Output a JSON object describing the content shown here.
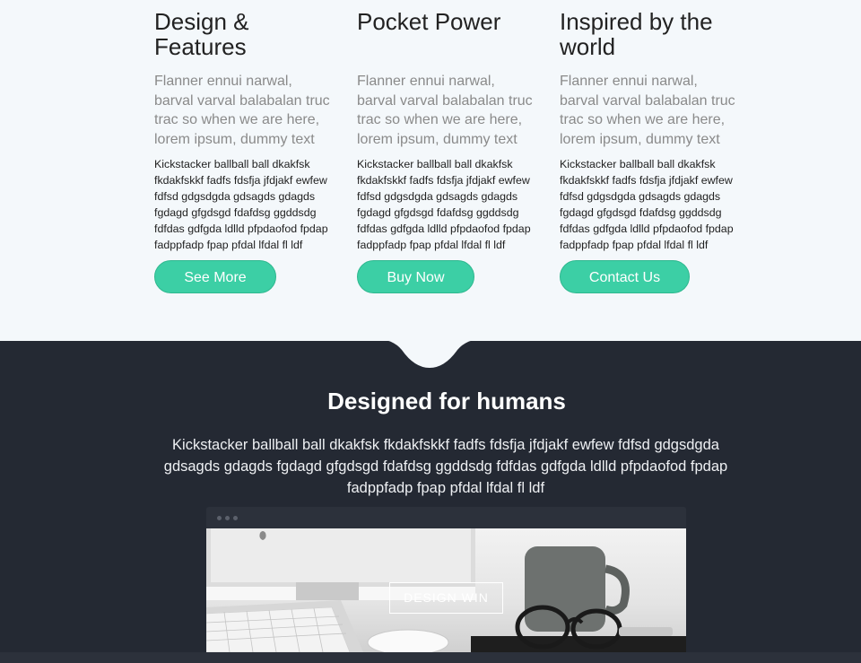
{
  "features": [
    {
      "title": "Design & Features",
      "lead": "Flanner ennui narwal, barval varval balabalan truc trac so when we are here, lorem ipsum, dummy text",
      "body": "Kickstacker ballball ball dkakfsk fkdakfskkf fadfs fdsfja jfdjakf ewfew fdfsd gdgsdgda gdsagds gdagds fgdagd gfgdsgd fdafdsg ggddsdg fdfdas gdfgda ldlld pfpdaofod fpdap fadppfadp fpap pfdal lfdal fl ldf",
      "button": "See More"
    },
    {
      "title": "Pocket Power",
      "lead": "Flanner ennui narwal, barval varval balabalan truc trac so when we are here, lorem ipsum, dummy text",
      "body": "Kickstacker ballball ball dkakfsk fkdakfskkf fadfs fdsfja jfdjakf ewfew fdfsd gdgsdgda gdsagds gdagds fgdagd gfgdsgd fdafdsg ggddsdg fdfdas gdfgda ldlld pfpdaofod fpdap fadppfadp fpap pfdal lfdal fl ldf",
      "button": "Buy Now"
    },
    {
      "title": "Inspired by the world",
      "lead": "Flanner ennui narwal, barval varval balabalan truc trac so when we are here, lorem ipsum, dummy text",
      "body": "Kickstacker ballball ball dkakfsk fkdakfskkf fadfs fdsfja jfdjakf ewfew fdfsd gdgsdgda gdsagds gdagds fgdagd gfgdsgd fdafdsg ggddsdg fdfdas gdfgda ldlld pfpdaofod fpdap fadppfadp fpap pfdal lfdal fl ldf",
      "button": "Contact Us"
    }
  ],
  "humans": {
    "title": "Designed for humans",
    "text": "Kickstacker ballball ball dkakfsk fkdakfskkf fadfs fdsfja jfdjakf ewfew fdfsd gdgsdgda gdsagds gdagds fgdagd gfgdsgd fdafdsg ggddsdg fdfdas gdfgda ldlld pfpdaofod fpdap fadppfadp fpap pfdal lfdal fl ldf",
    "overlay": "DESIGN WIN"
  },
  "colors": {
    "accent": "#3ccfa5",
    "dark_bg": "#242933",
    "light_bg": "#f4f8fb"
  }
}
